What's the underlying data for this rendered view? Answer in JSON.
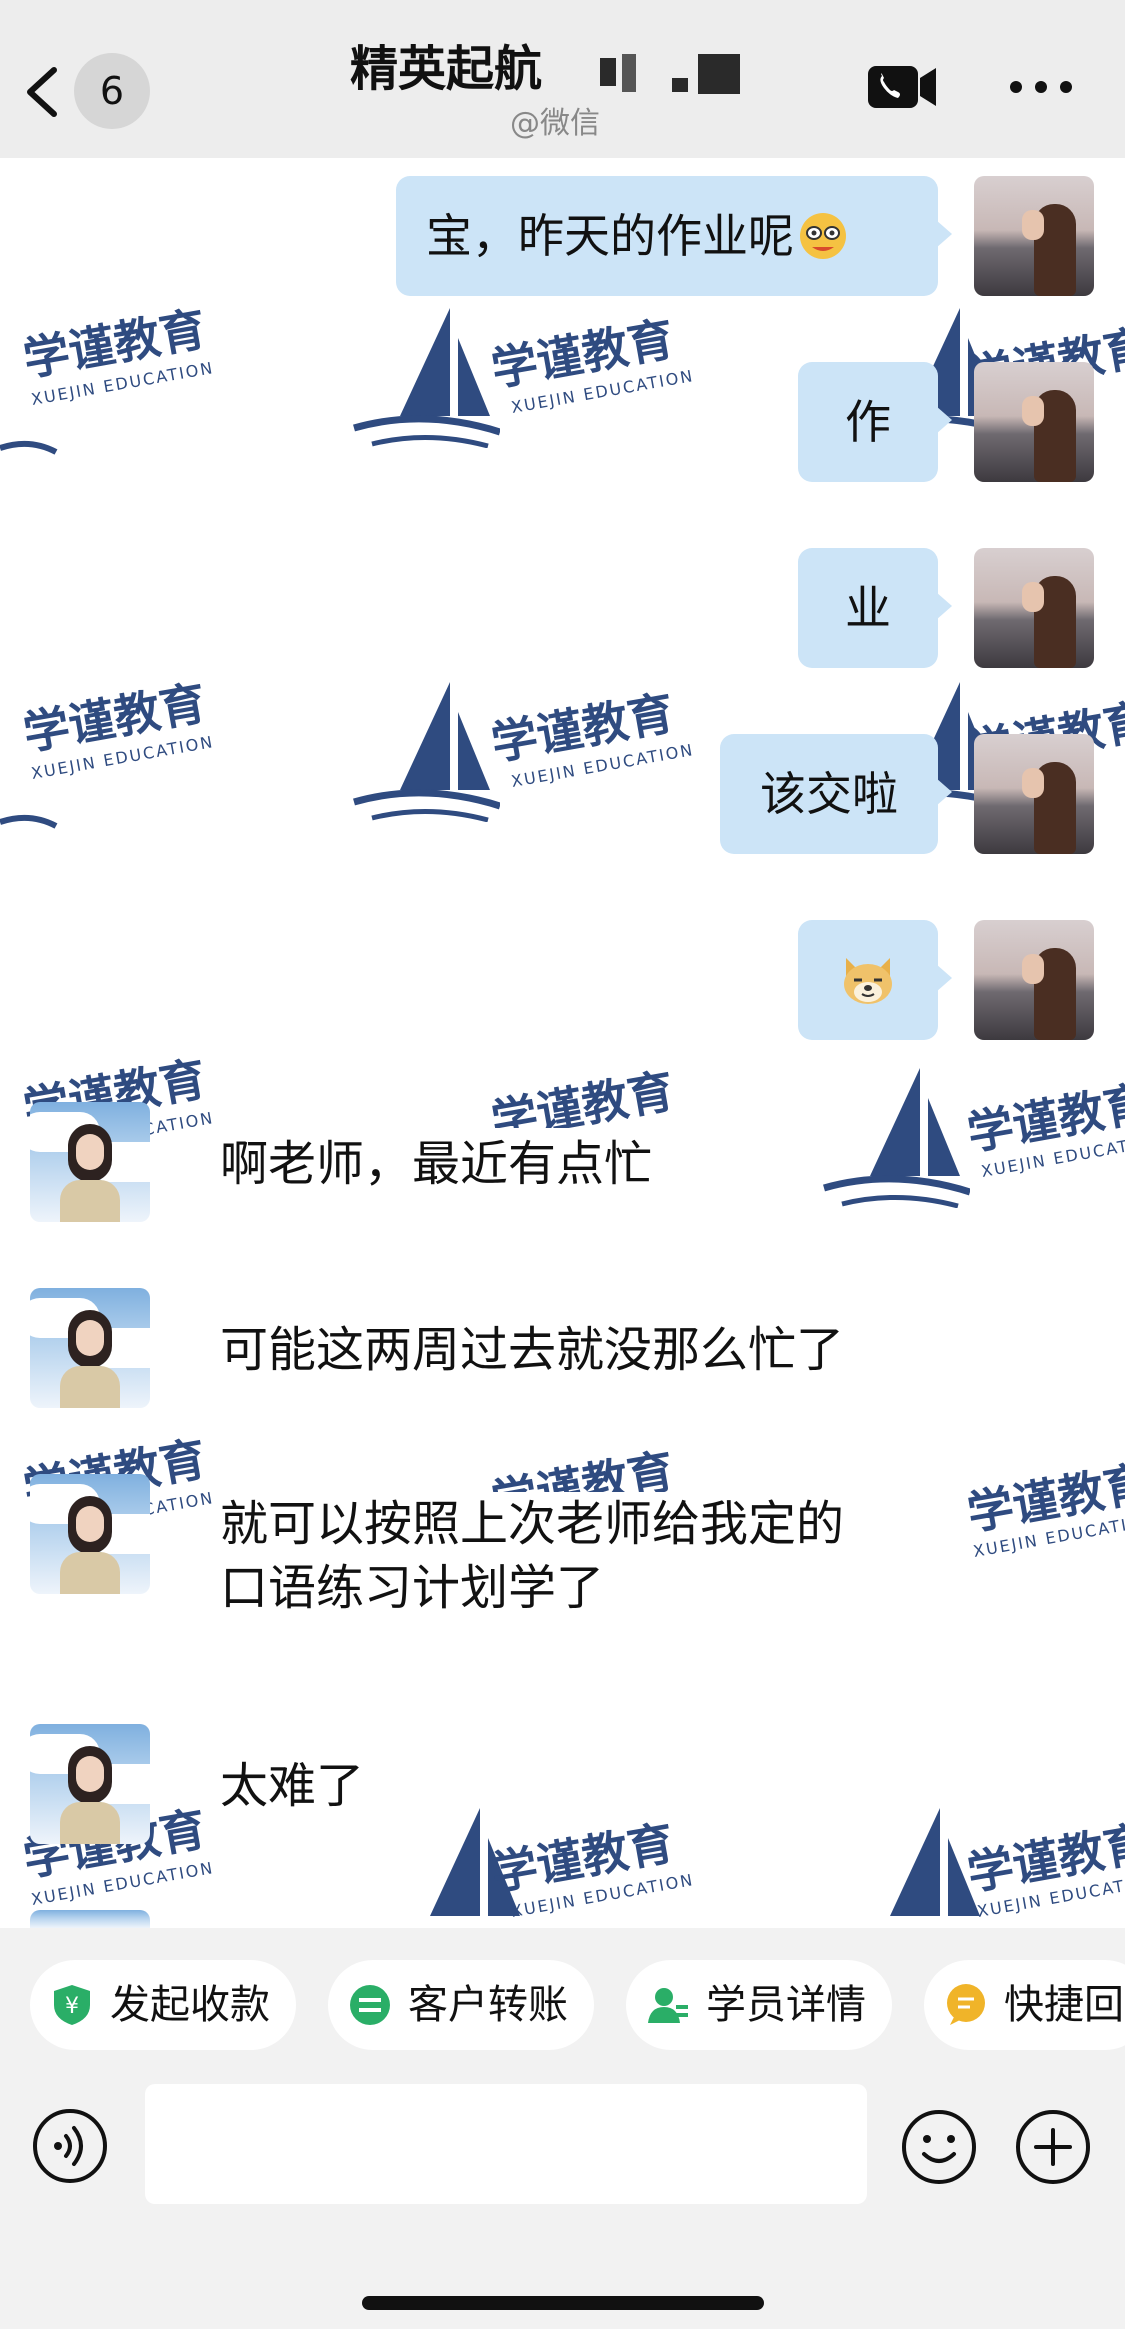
{
  "header": {
    "unread_count": "6",
    "title": "精英起航",
    "subtitle": "@微信"
  },
  "watermark": {
    "name": "学谨教育",
    "sub": "XUEJIN EDUCATION"
  },
  "messages": [
    {
      "side": "out",
      "text": "宝，昨天的作业呢",
      "emoji": "smirk-emoji"
    },
    {
      "side": "out",
      "text": "作"
    },
    {
      "side": "out",
      "text": "业"
    },
    {
      "side": "out",
      "text": "该交啦"
    },
    {
      "side": "out",
      "text": "",
      "emoji": "doge-emoji"
    },
    {
      "side": "in",
      "text": "啊老师，最近有点忙"
    },
    {
      "side": "in",
      "text": "可能这两周过去就没那么忙了"
    },
    {
      "side": "in",
      "lines": [
        "就可以按照上次老师给我定的",
        "口语练习计划学了"
      ]
    },
    {
      "side": "in",
      "text": "太难了"
    }
  ],
  "quick_actions": [
    {
      "label": "发起收款",
      "icon": "payment-shield-icon",
      "color": "#2aae67"
    },
    {
      "label": "客户转账",
      "icon": "transfer-icon",
      "color": "#2aae67"
    },
    {
      "label": "学员详情",
      "icon": "student-icon",
      "color": "#2aae67"
    },
    {
      "label": "快捷回",
      "icon": "quick-reply-icon",
      "color": "#f0b429"
    }
  ],
  "colors": {
    "bubble_out": "#cce4f7",
    "header_bg": "#ededed",
    "watermark": "#24427a"
  }
}
